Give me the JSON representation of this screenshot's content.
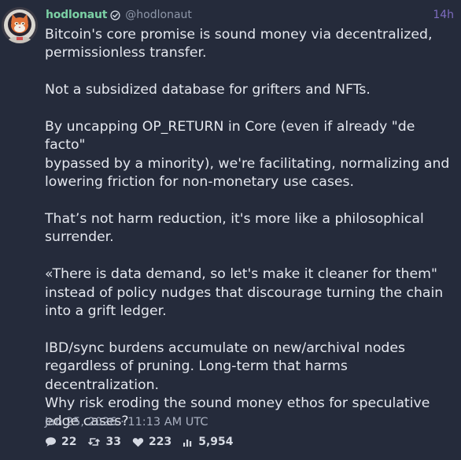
{
  "post": {
    "author": {
      "display_name": "hodlonaut",
      "handle": "@hodlonaut",
      "verified": true,
      "avatar": "astronaut-cat-avatar"
    },
    "relative_time": "14h",
    "paragraphs": [
      "Bitcoin's core promise is sound money via decentralized,\npermissionless transfer.",
      "Not a subsidized database for grifters and NFTs.",
      "By uncapping OP_RETURN in Core (even if already \"de facto\"\nbypassed by a minority), we're facilitating, normalizing and\nlowering friction for non-monetary use cases.",
      "That’s not harm reduction, it's more like a philosophical\nsurrender.",
      "«There is data demand, so let's make it cleaner for them\"\ninstead of policy nudges that discourage turning the chain\ninto a grift ledger.",
      "IBD/sync burdens accumulate on new/archival nodes\nregardless of pruning. Long-term that harms\ndecentralization.\nWhy risk eroding the sound money ethos for speculative\nedge cases?"
    ],
    "timestamp": "Jan 25, 2026 · 11:13 AM UTC",
    "stats": {
      "replies": "22",
      "reposts": "33",
      "likes": "223",
      "views": "5,954"
    }
  },
  "colors": {
    "background": "#252b3b",
    "name": "#7bd0a4",
    "handle": "#8e97a9",
    "time": "#7e6cc0",
    "text": "#e4e7ee"
  }
}
